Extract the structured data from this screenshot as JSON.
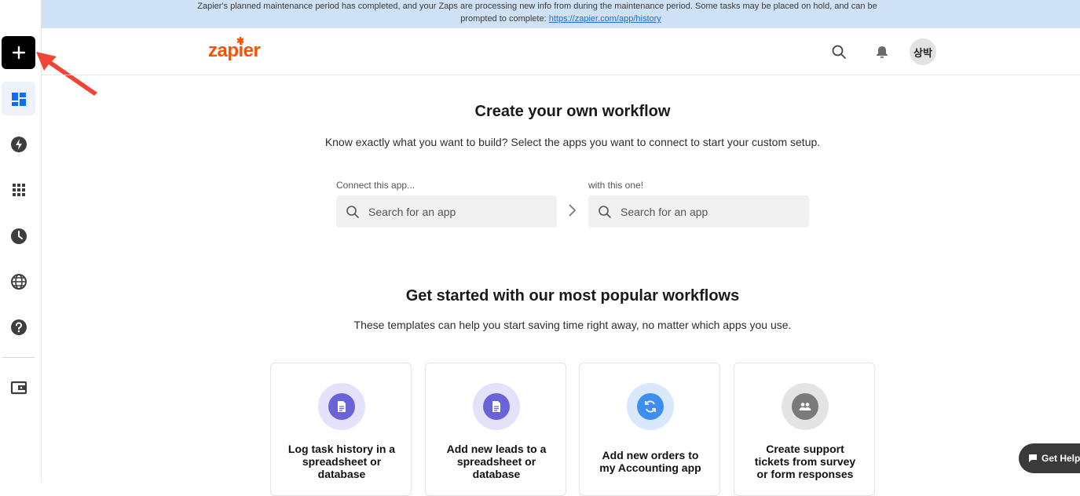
{
  "banner": {
    "text": "Zapier's planned maintenance period has completed, and your Zaps are processing new info from during the maintenance period. Some tasks may be placed on hold, and can be",
    "text2": "prompted to complete:",
    "link": "https://zapier.com/app/history"
  },
  "sidebar": {
    "create_icon": "plus-icon",
    "items": [
      {
        "icon": "dashboard-icon",
        "active": true
      },
      {
        "icon": "zap-icon"
      },
      {
        "icon": "apps-grid-icon"
      },
      {
        "icon": "history-clock-icon"
      },
      {
        "icon": "globe-icon"
      },
      {
        "icon": "help-icon"
      },
      {
        "icon": "wallet-icon"
      }
    ]
  },
  "header": {
    "logo": "zapier",
    "avatar": "상박"
  },
  "workflow": {
    "title": "Create your own workflow",
    "subtitle": "Know exactly what you want to build? Select the apps you want to connect to start your custom setup.",
    "left_label": "Connect this app...",
    "right_label": "with this one!",
    "left_placeholder": "Search for an app",
    "right_placeholder": "Search for an app"
  },
  "popular": {
    "title": "Get started with our most popular workflows",
    "subtitle": "These templates can help you start saving time right away, no matter which apps you use.",
    "cards": [
      {
        "line1": "Log task history in a",
        "line2": "spreadsheet or",
        "line3": "database",
        "icon": "document-icon"
      },
      {
        "line1": "Add new leads to a",
        "line2": "spreadsheet or",
        "line3": "database",
        "icon": "document-icon"
      },
      {
        "line1": "Add new orders to",
        "line2": "my Accounting app",
        "icon": "sync-icon"
      },
      {
        "line1": "Create support",
        "line2": "tickets from survey",
        "line3": "or form responses",
        "icon": "people-icon"
      }
    ]
  },
  "help": {
    "label": "Get Help"
  },
  "colors": {
    "brand": "#ff4f00",
    "banner": "#cfe2f5",
    "accent": "#136bf5"
  }
}
